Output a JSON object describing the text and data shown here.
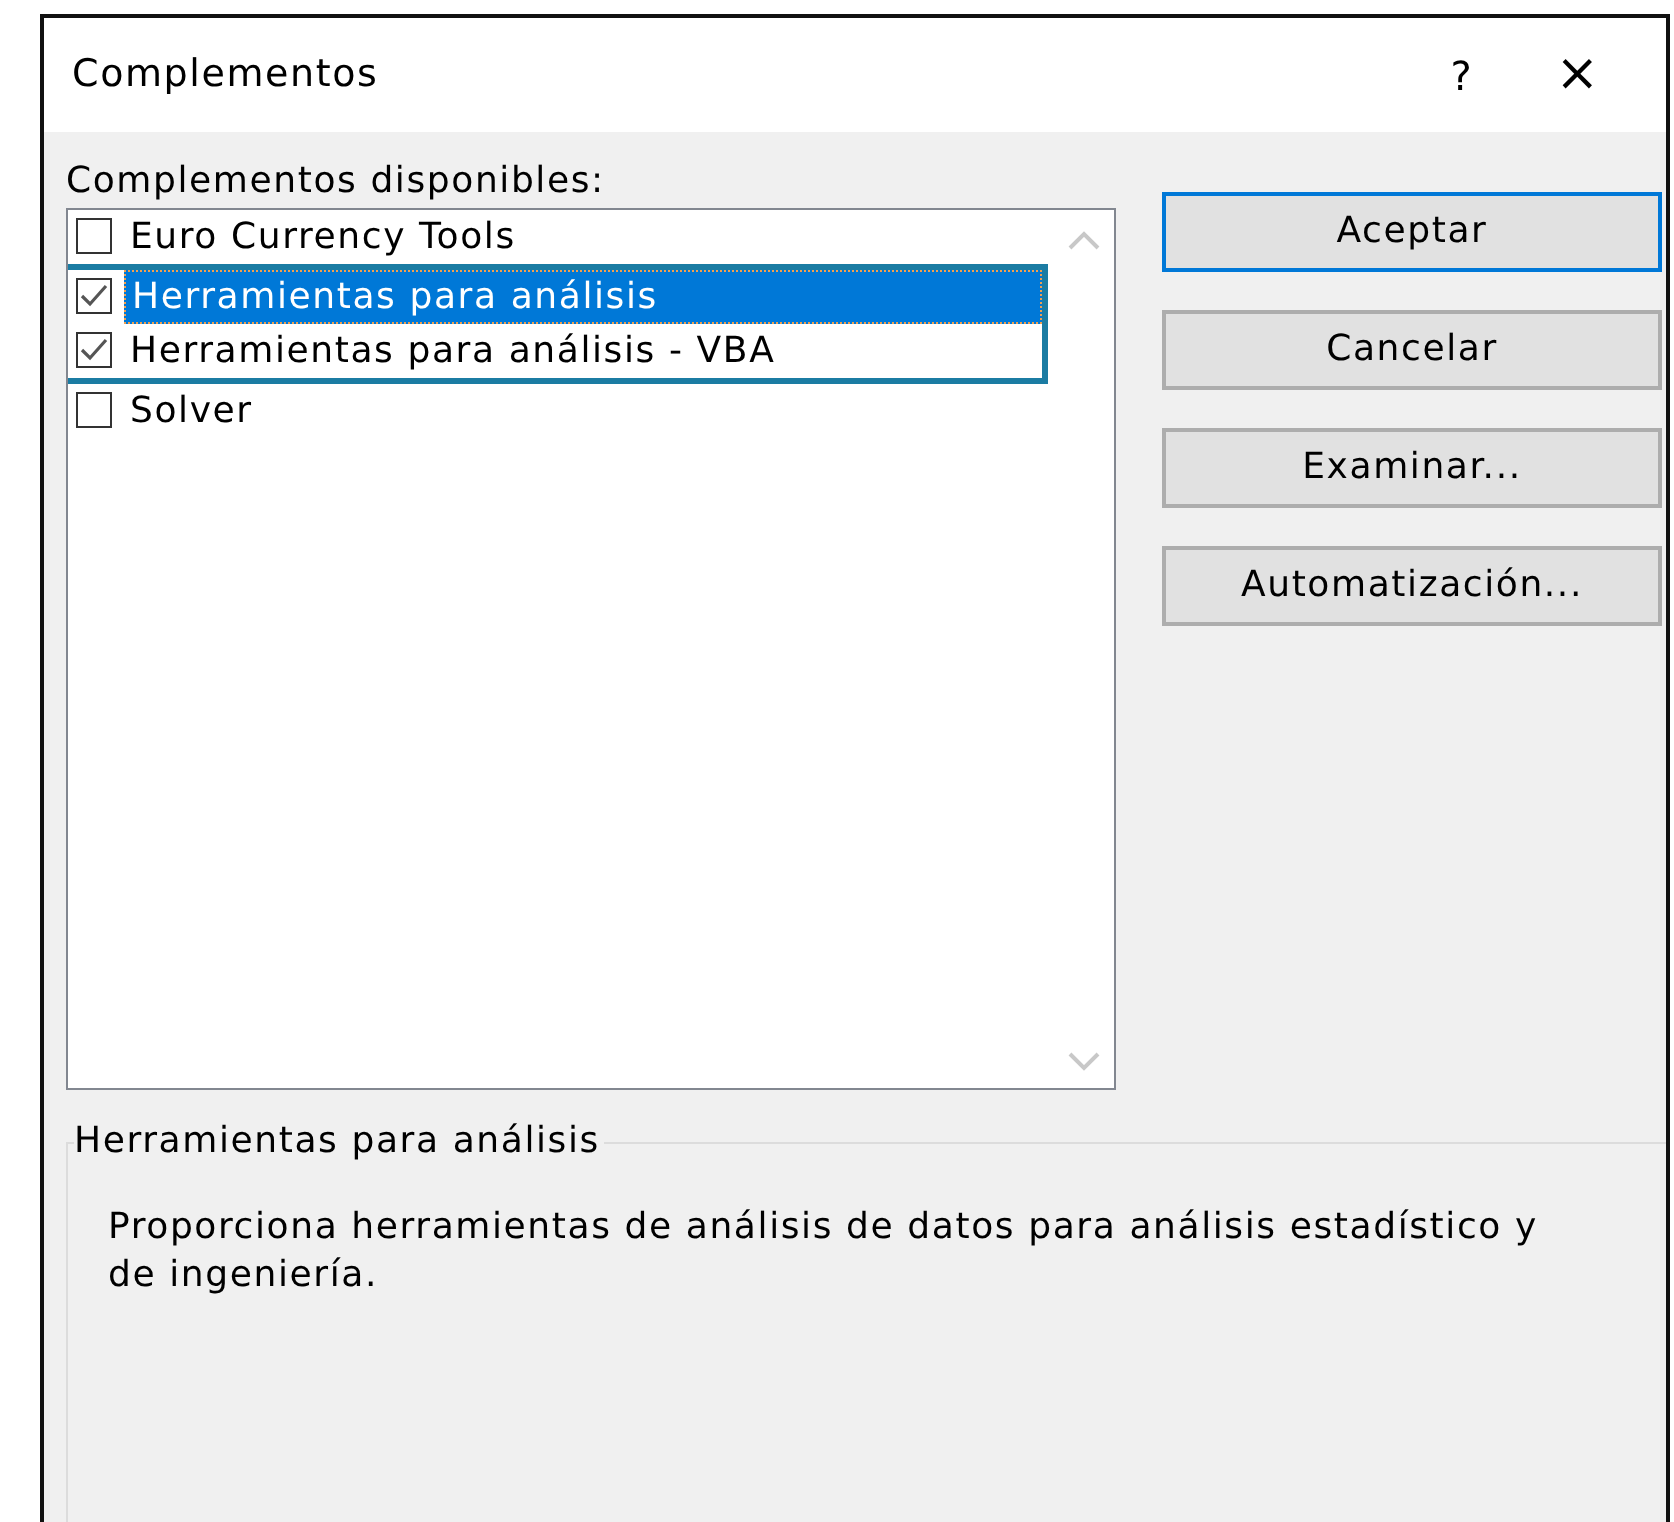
{
  "window": {
    "title": "Complementos",
    "help": "?",
    "close": "×"
  },
  "list_label": "Complementos disponibles:",
  "addins": [
    {
      "label": "Euro Currency Tools",
      "checked": false,
      "selected": false,
      "framed": false
    },
    {
      "label": "Herramientas para análisis",
      "checked": true,
      "selected": true,
      "framed": true
    },
    {
      "label": "Herramientas para análisis - VBA",
      "checked": true,
      "selected": false,
      "framed": true
    },
    {
      "label": "Solver",
      "checked": false,
      "selected": false,
      "framed": false
    }
  ],
  "buttons": [
    {
      "label": "Aceptar",
      "default": true
    },
    {
      "label": "Cancelar",
      "default": false
    },
    {
      "label": "Examinar...",
      "default": false
    },
    {
      "label": "Automatización...",
      "default": false
    }
  ],
  "description": {
    "title": "Herramientas para análisis",
    "text": "Proporciona herramientas de análisis de datos para análisis estadístico y de ingeniería."
  }
}
